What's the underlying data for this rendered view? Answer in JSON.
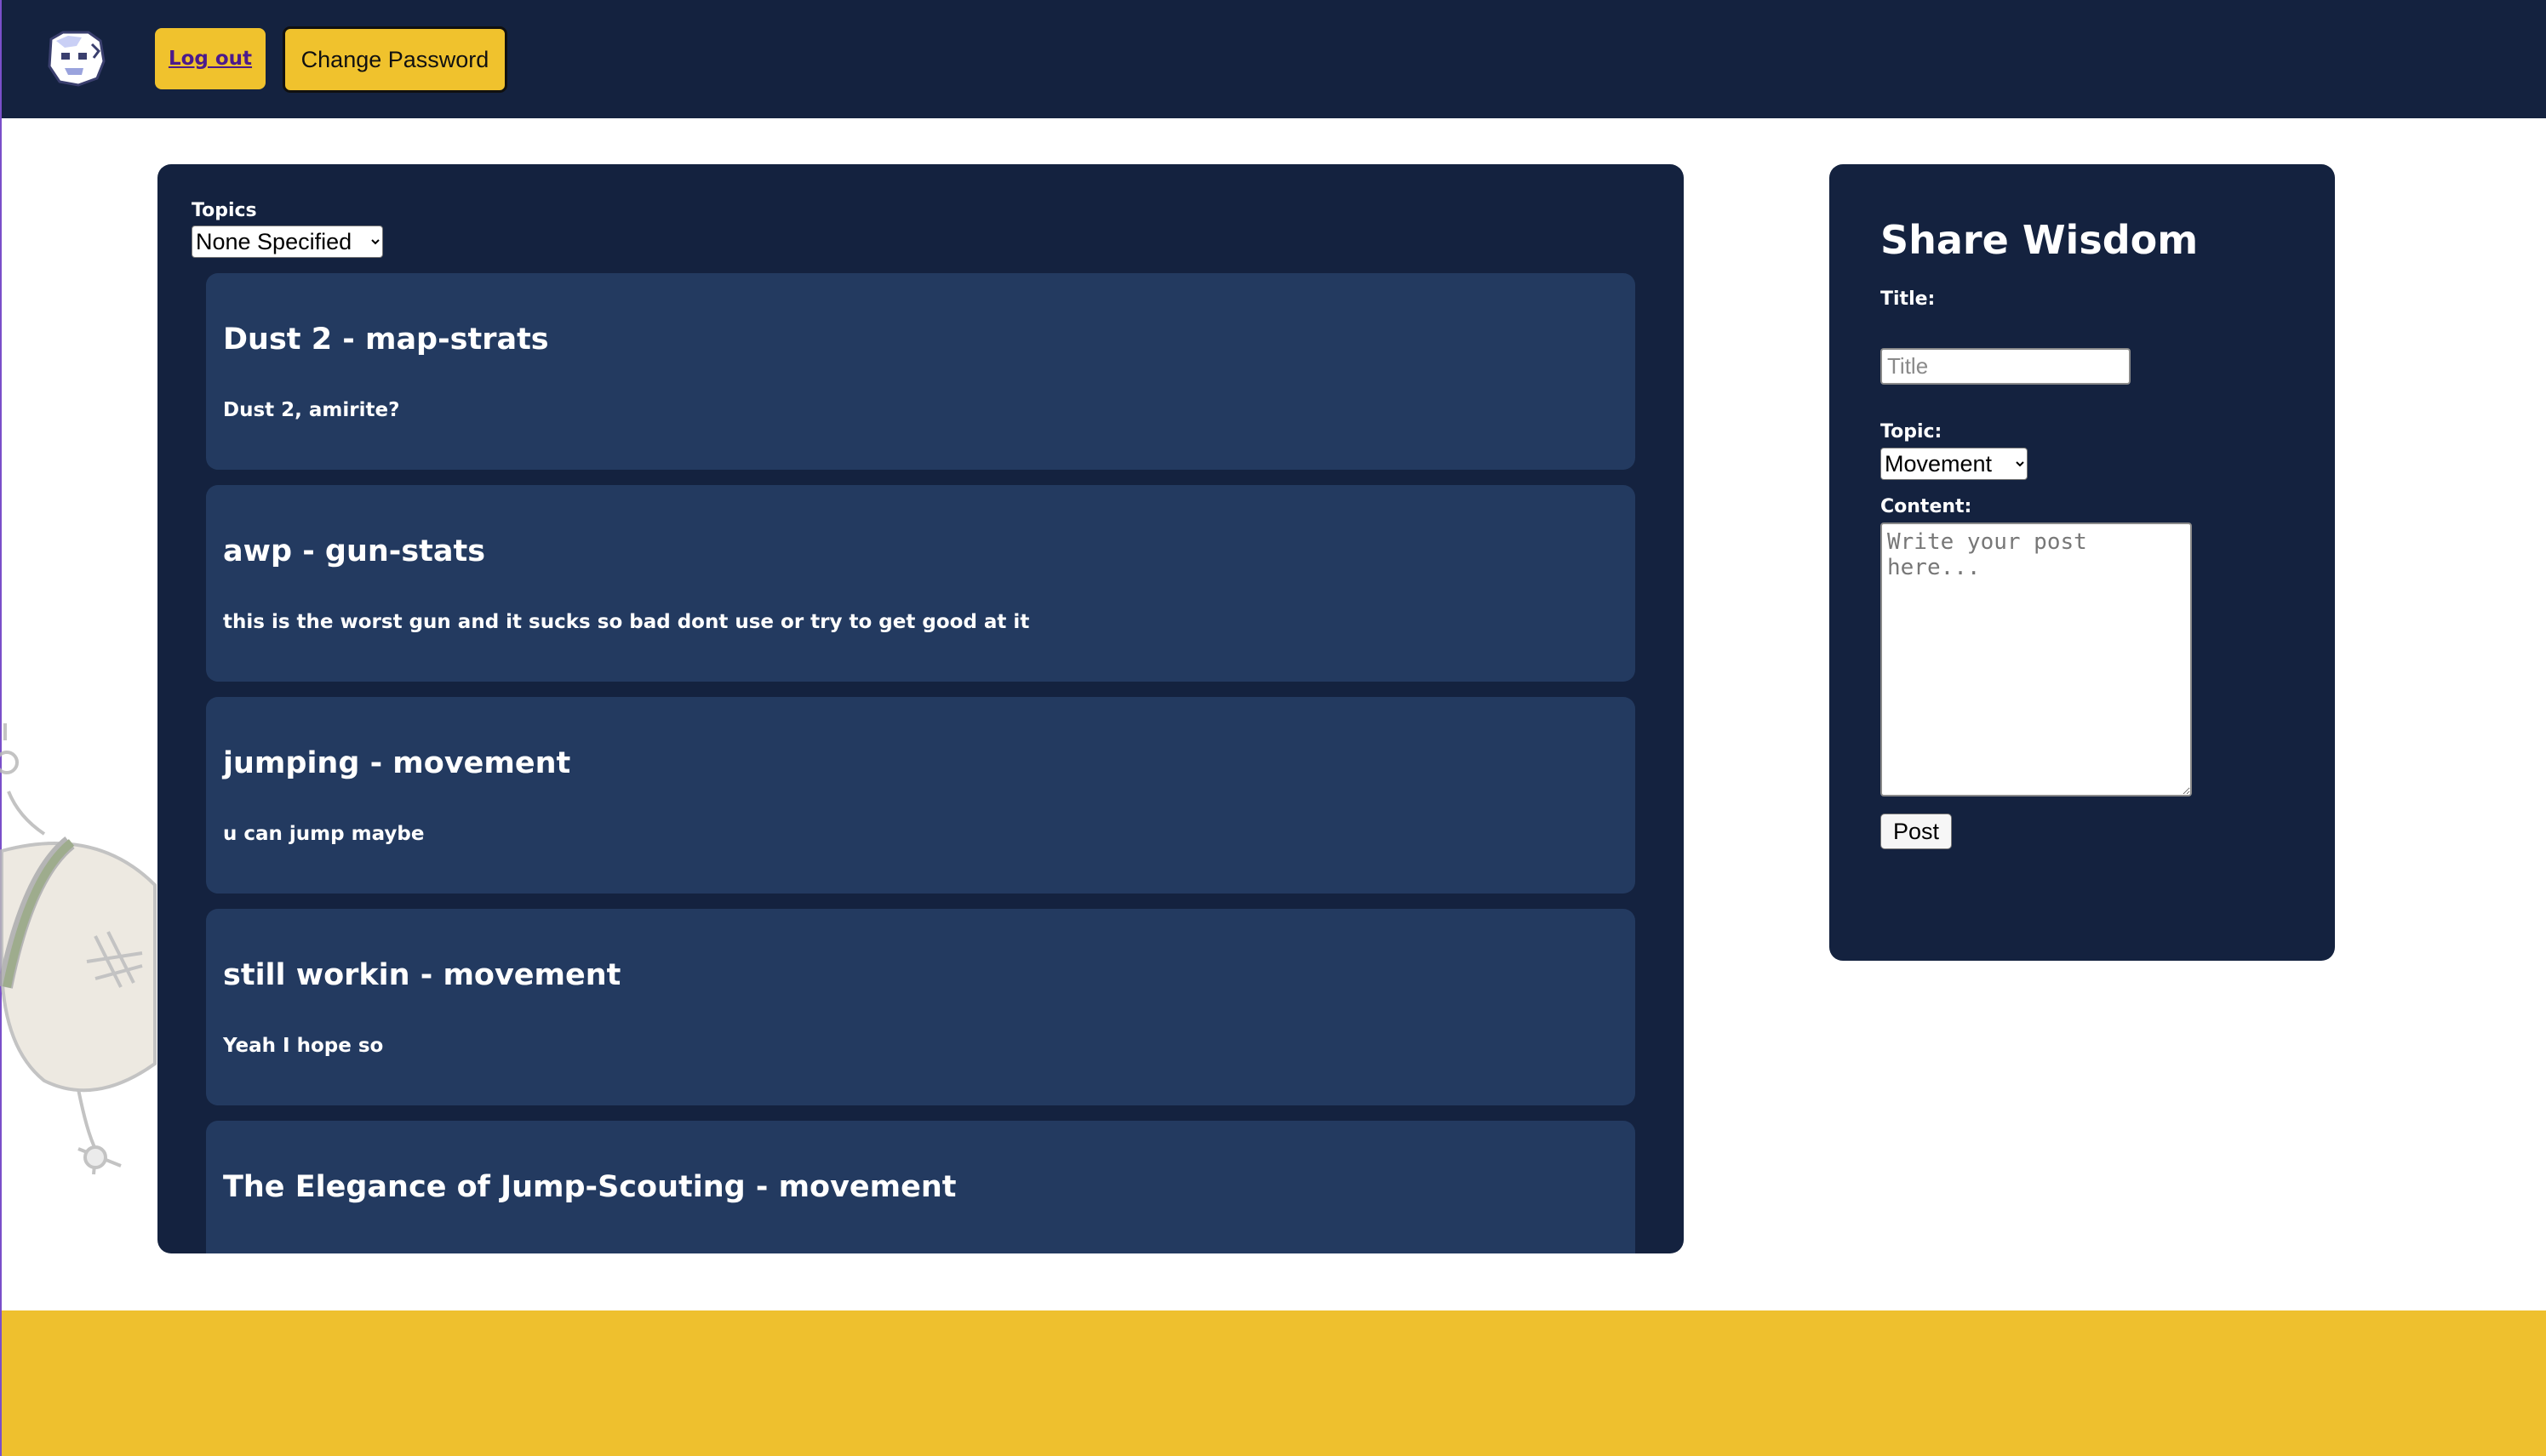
{
  "header": {
    "logout_label": "Log out",
    "change_password_label": "Change Password"
  },
  "feed": {
    "topics_label": "Topics",
    "topics_selected": "None Specified",
    "posts": [
      {
        "title": "Dust 2 - map-strats",
        "body": "Dust 2, amirite?"
      },
      {
        "title": "awp - gun-stats",
        "body": "this is the worst gun and it sucks so bad dont use or try to get good at it"
      },
      {
        "title": "jumping - movement",
        "body": "u can jump maybe"
      },
      {
        "title": "still workin - movement",
        "body": "Yeah I hope so"
      },
      {
        "title": "The Elegance of Jump-Scouting - movement",
        "body": ""
      }
    ]
  },
  "share": {
    "heading": "Share Wisdom",
    "title_label": "Title:",
    "title_placeholder": "Title",
    "topic_label": "Topic:",
    "topic_selected": "Movement",
    "content_label": "Content:",
    "content_placeholder": "Write your post here...",
    "post_button": "Post"
  },
  "colors": {
    "nav_bg": "#14223f",
    "panel_bg": "#14223f",
    "card_bg": "#233a60",
    "accent_yellow": "#f0c22d"
  }
}
